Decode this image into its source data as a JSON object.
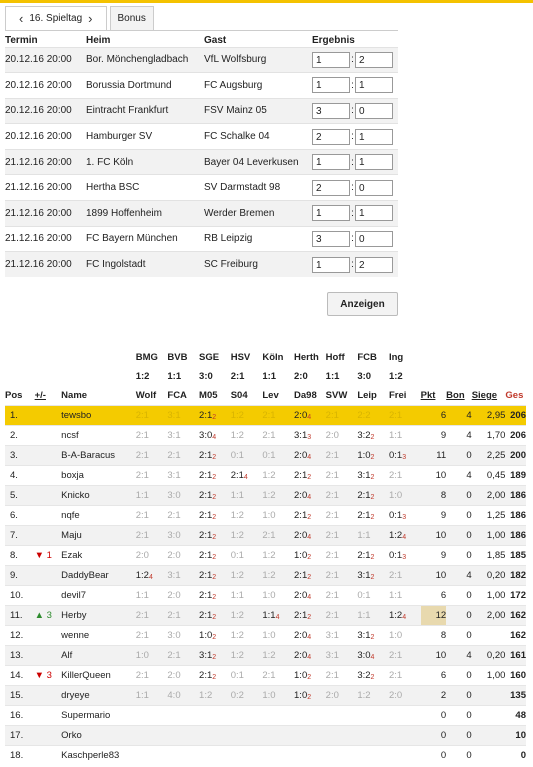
{
  "matchday": {
    "label": "16. Spieltag",
    "prev": "‹",
    "next": "›"
  },
  "bonus_tab": "Bonus",
  "fixtures": {
    "headers": [
      "Termin",
      "Heim",
      "Gast",
      "Ergebnis"
    ],
    "rows": [
      {
        "date": "20.12.16 20:00",
        "home": "Bor. Mönchengladbach",
        "away": "VfL Wolfsburg",
        "h": "1",
        "a": "2"
      },
      {
        "date": "20.12.16 20:00",
        "home": "Borussia Dortmund",
        "away": "FC Augsburg",
        "h": "1",
        "a": "1"
      },
      {
        "date": "20.12.16 20:00",
        "home": "Eintracht Frankfurt",
        "away": "FSV Mainz 05",
        "h": "3",
        "a": "0"
      },
      {
        "date": "20.12.16 20:00",
        "home": "Hamburger SV",
        "away": "FC Schalke 04",
        "h": "2",
        "a": "1"
      },
      {
        "date": "21.12.16 20:00",
        "home": "1. FC Köln",
        "away": "Bayer 04 Leverkusen",
        "h": "1",
        "a": "1"
      },
      {
        "date": "21.12.16 20:00",
        "home": "Hertha BSC",
        "away": "SV Darmstadt 98",
        "h": "2",
        "a": "0"
      },
      {
        "date": "21.12.16 20:00",
        "home": "1899 Hoffenheim",
        "away": "Werder Bremen",
        "h": "1",
        "a": "1"
      },
      {
        "date": "21.12.16 20:00",
        "home": "FC Bayern München",
        "away": "RB Leipzig",
        "h": "3",
        "a": "0"
      },
      {
        "date": "21.12.16 20:00",
        "home": "FC Ingolstadt",
        "away": "SC Freiburg",
        "h": "1",
        "a": "2"
      }
    ]
  },
  "submit_label": "Anzeigen",
  "standings": {
    "match_headers": [
      {
        "t1": "BMG",
        "r": "1:2",
        "t2": "Wolf"
      },
      {
        "t1": "BVB",
        "r": "1:1",
        "t2": "FCA"
      },
      {
        "t1": "SGE",
        "r": "3:0",
        "t2": "M05"
      },
      {
        "t1": "HSV",
        "r": "2:1",
        "t2": "S04"
      },
      {
        "t1": "Köln",
        "r": "1:1",
        "t2": "Lev"
      },
      {
        "t1": "Herth",
        "r": "2:0",
        "t2": "Da98"
      },
      {
        "t1": "Hoff",
        "r": "1:1",
        "t2": "SVW"
      },
      {
        "t1": "FCB",
        "r": "3:0",
        "t2": "Leip"
      },
      {
        "t1": "Ing",
        "r": "1:2",
        "t2": "Frei"
      }
    ],
    "col_headers": {
      "pos": "Pos",
      "diff": "+/-",
      "name": "Name",
      "pkt": "Pkt",
      "bon": "Bon",
      "siege": "Siege",
      "ges": "Ges"
    },
    "rows": [
      {
        "pos": "1.",
        "diff": "",
        "name": "tewsbo",
        "tips": [
          [
            "2:1",
            ""
          ],
          [
            "3:1",
            ""
          ],
          [
            "2:1",
            "2"
          ],
          [
            "1:2",
            ""
          ],
          [
            "2:1",
            ""
          ],
          [
            "2:0",
            "4"
          ],
          [
            "2:1",
            ""
          ],
          [
            "2:2",
            ""
          ],
          [
            "2:1",
            ""
          ]
        ],
        "pkt": "6",
        "bon": "4",
        "siege": "2,95",
        "ges": "206"
      },
      {
        "pos": "2.",
        "diff": "",
        "name": "ncsf",
        "tips": [
          [
            "2:1",
            ""
          ],
          [
            "3:1",
            ""
          ],
          [
            "3:0",
            "4"
          ],
          [
            "1:2",
            ""
          ],
          [
            "2:1",
            ""
          ],
          [
            "3:1",
            "3"
          ],
          [
            "2:0",
            ""
          ],
          [
            "3:2",
            "2"
          ],
          [
            "1:1",
            ""
          ]
        ],
        "pkt": "9",
        "bon": "4",
        "siege": "1,70",
        "ges": "206"
      },
      {
        "pos": "3.",
        "diff": "",
        "name": "B-A-Baracus",
        "tips": [
          [
            "2:1",
            ""
          ],
          [
            "2:1",
            ""
          ],
          [
            "2:1",
            "2"
          ],
          [
            "0:1",
            ""
          ],
          [
            "0:1",
            ""
          ],
          [
            "2:0",
            "4"
          ],
          [
            "2:1",
            ""
          ],
          [
            "1:0",
            "2"
          ],
          [
            "0:1",
            "3"
          ]
        ],
        "pkt": "11",
        "bon": "0",
        "siege": "2,25",
        "ges": "200"
      },
      {
        "pos": "4.",
        "diff": "",
        "name": "boxja",
        "tips": [
          [
            "2:1",
            ""
          ],
          [
            "3:1",
            ""
          ],
          [
            "2:1",
            "2"
          ],
          [
            "2:1",
            "4"
          ],
          [
            "1:2",
            ""
          ],
          [
            "2:1",
            "2"
          ],
          [
            "2:1",
            ""
          ],
          [
            "3:1",
            "2"
          ],
          [
            "2:1",
            ""
          ]
        ],
        "pkt": "10",
        "bon": "4",
        "siege": "0,45",
        "ges": "189"
      },
      {
        "pos": "5.",
        "diff": "",
        "name": "Knicko",
        "tips": [
          [
            "1:1",
            ""
          ],
          [
            "3:0",
            ""
          ],
          [
            "2:1",
            "2"
          ],
          [
            "1:1",
            ""
          ],
          [
            "1:2",
            ""
          ],
          [
            "2:0",
            "4"
          ],
          [
            "2:1",
            ""
          ],
          [
            "2:1",
            "2"
          ],
          [
            "1:0",
            ""
          ]
        ],
        "pkt": "8",
        "bon": "0",
        "siege": "2,00",
        "ges": "186"
      },
      {
        "pos": "6.",
        "diff": "",
        "name": "nqfe",
        "tips": [
          [
            "2:1",
            ""
          ],
          [
            "2:1",
            ""
          ],
          [
            "2:1",
            "2"
          ],
          [
            "1:2",
            ""
          ],
          [
            "1:0",
            ""
          ],
          [
            "2:1",
            "2"
          ],
          [
            "2:1",
            ""
          ],
          [
            "2:1",
            "2"
          ],
          [
            "0:1",
            "3"
          ]
        ],
        "pkt": "9",
        "bon": "0",
        "siege": "1,25",
        "ges": "186"
      },
      {
        "pos": "7.",
        "diff": "",
        "name": "Maju",
        "tips": [
          [
            "2:1",
            ""
          ],
          [
            "3:0",
            ""
          ],
          [
            "2:1",
            "2"
          ],
          [
            "1:2",
            ""
          ],
          [
            "2:1",
            ""
          ],
          [
            "2:0",
            "4"
          ],
          [
            "2:1",
            ""
          ],
          [
            "1:1",
            ""
          ],
          [
            "1:2",
            "4"
          ]
        ],
        "pkt": "10",
        "bon": "0",
        "siege": "1,00",
        "ges": "186"
      },
      {
        "pos": "8.",
        "diff": "▼ 1",
        "name": "Ezak",
        "tips": [
          [
            "2:0",
            ""
          ],
          [
            "2:0",
            ""
          ],
          [
            "2:1",
            "2"
          ],
          [
            "0:1",
            ""
          ],
          [
            "1:2",
            ""
          ],
          [
            "1:0",
            "2"
          ],
          [
            "2:1",
            ""
          ],
          [
            "2:1",
            "2"
          ],
          [
            "0:1",
            "3"
          ]
        ],
        "pkt": "9",
        "bon": "0",
        "siege": "1,85",
        "ges": "185"
      },
      {
        "pos": "9.",
        "diff": "",
        "name": "DaddyBear",
        "tips": [
          [
            "1:2",
            "4"
          ],
          [
            "3:1",
            ""
          ],
          [
            "2:1",
            "2"
          ],
          [
            "1:2",
            ""
          ],
          [
            "1:2",
            ""
          ],
          [
            "2:1",
            "2"
          ],
          [
            "2:1",
            ""
          ],
          [
            "3:1",
            "2"
          ],
          [
            "2:1",
            ""
          ]
        ],
        "pkt": "10",
        "bon": "4",
        "siege": "0,20",
        "ges": "182"
      },
      {
        "pos": "10.",
        "diff": "",
        "name": "devil7",
        "tips": [
          [
            "1:1",
            ""
          ],
          [
            "2:0",
            ""
          ],
          [
            "2:1",
            "2"
          ],
          [
            "1:1",
            ""
          ],
          [
            "1:0",
            ""
          ],
          [
            "2:0",
            "4"
          ],
          [
            "2:1",
            ""
          ],
          [
            "0:1",
            ""
          ],
          [
            "1:1",
            ""
          ]
        ],
        "pkt": "6",
        "bon": "0",
        "siege": "1,00",
        "ges": "172"
      },
      {
        "pos": "11.",
        "diff": "▲ 3",
        "name": "Herby",
        "tips": [
          [
            "2:1",
            ""
          ],
          [
            "2:1",
            ""
          ],
          [
            "2:1",
            "2"
          ],
          [
            "1:2",
            ""
          ],
          [
            "1:1",
            "4"
          ],
          [
            "2:1",
            "2"
          ],
          [
            "2:1",
            ""
          ],
          [
            "1:1",
            ""
          ],
          [
            "1:2",
            "4"
          ]
        ],
        "pkt": "12",
        "bon": "0",
        "siege": "2,00",
        "ges": "162",
        "hl": true
      },
      {
        "pos": "12.",
        "diff": "",
        "name": "wenne",
        "tips": [
          [
            "2:1",
            ""
          ],
          [
            "3:0",
            ""
          ],
          [
            "1:0",
            "2"
          ],
          [
            "1:2",
            ""
          ],
          [
            "1:0",
            ""
          ],
          [
            "2:0",
            "4"
          ],
          [
            "3:1",
            ""
          ],
          [
            "3:1",
            "2"
          ],
          [
            "1:0",
            ""
          ]
        ],
        "pkt": "8",
        "bon": "0",
        "siege": "",
        "ges": "162"
      },
      {
        "pos": "13.",
        "diff": "",
        "name": "Alf",
        "tips": [
          [
            "1:0",
            ""
          ],
          [
            "2:1",
            ""
          ],
          [
            "3:1",
            "2"
          ],
          [
            "1:2",
            ""
          ],
          [
            "1:2",
            ""
          ],
          [
            "2:0",
            "4"
          ],
          [
            "3:1",
            ""
          ],
          [
            "3:0",
            "4"
          ],
          [
            "2:1",
            ""
          ]
        ],
        "pkt": "10",
        "bon": "4",
        "siege": "0,20",
        "ges": "161"
      },
      {
        "pos": "14.",
        "diff": "▼ 3",
        "name": "KillerQueen",
        "tips": [
          [
            "2:1",
            ""
          ],
          [
            "2:0",
            ""
          ],
          [
            "2:1",
            "2"
          ],
          [
            "0:1",
            ""
          ],
          [
            "2:1",
            ""
          ],
          [
            "1:0",
            "2"
          ],
          [
            "2:1",
            ""
          ],
          [
            "3:2",
            "2"
          ],
          [
            "2:1",
            ""
          ]
        ],
        "pkt": "6",
        "bon": "0",
        "siege": "1,00",
        "ges": "160"
      },
      {
        "pos": "15.",
        "diff": "",
        "name": "dryeye",
        "tips": [
          [
            "1:1",
            ""
          ],
          [
            "4:0",
            ""
          ],
          [
            "1:2",
            ""
          ],
          [
            "0:2",
            ""
          ],
          [
            "1:0",
            ""
          ],
          [
            "1:0",
            "2"
          ],
          [
            "2:0",
            ""
          ],
          [
            "1:2",
            ""
          ],
          [
            "2:0",
            ""
          ]
        ],
        "pkt": "2",
        "bon": "0",
        "siege": "",
        "ges": "135"
      },
      {
        "pos": "16.",
        "diff": "",
        "name": "Supermario",
        "tips": [
          [
            "",
            ""
          ],
          [
            "",
            ""
          ],
          [
            "",
            ""
          ],
          [
            "",
            ""
          ],
          [
            "",
            ""
          ],
          [
            "",
            ""
          ],
          [
            "",
            ""
          ],
          [
            "",
            ""
          ],
          [
            "",
            ""
          ]
        ],
        "pkt": "0",
        "bon": "0",
        "siege": "",
        "ges": "48"
      },
      {
        "pos": "17.",
        "diff": "",
        "name": "Orko",
        "tips": [
          [
            "",
            ""
          ],
          [
            "",
            ""
          ],
          [
            "",
            ""
          ],
          [
            "",
            ""
          ],
          [
            "",
            ""
          ],
          [
            "",
            ""
          ],
          [
            "",
            ""
          ],
          [
            "",
            ""
          ],
          [
            "",
            ""
          ]
        ],
        "pkt": "0",
        "bon": "0",
        "siege": "",
        "ges": "10"
      },
      {
        "pos": "18.",
        "diff": "",
        "name": "Kaschperle83",
        "tips": [
          [
            "",
            ""
          ],
          [
            "",
            ""
          ],
          [
            "",
            ""
          ],
          [
            "",
            ""
          ],
          [
            "",
            ""
          ],
          [
            "",
            ""
          ],
          [
            "",
            ""
          ],
          [
            "",
            ""
          ],
          [
            "",
            ""
          ]
        ],
        "pkt": "0",
        "bon": "0",
        "siege": "",
        "ges": "0"
      }
    ]
  }
}
